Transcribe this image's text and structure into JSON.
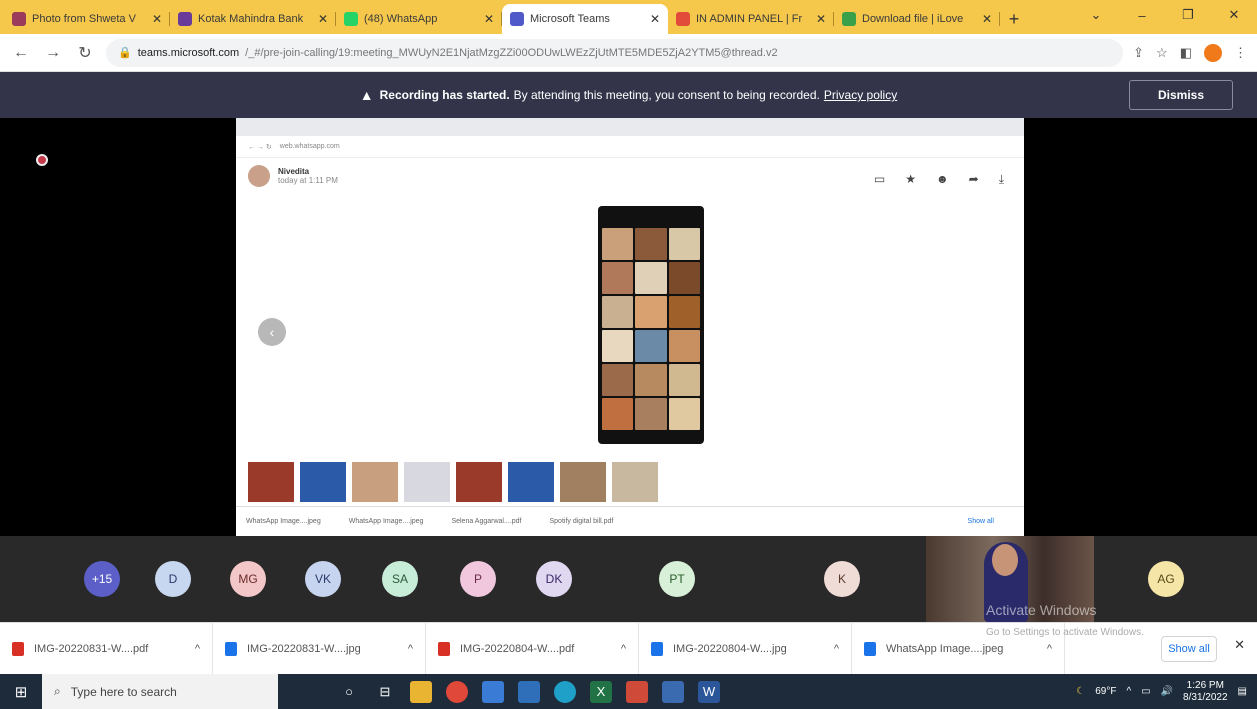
{
  "tabs": [
    {
      "title": "Photo from Shweta V",
      "favicon_color": "#9b3a5a",
      "close": "✕"
    },
    {
      "title": "Kotak Mahindra Bank",
      "favicon_color": "#6a3a9a",
      "close": "✕"
    },
    {
      "title": "(48) WhatsApp",
      "favicon_color": "#25d366",
      "close": "✕"
    },
    {
      "title": "Microsoft Teams",
      "favicon_color": "#5059c9",
      "close": "✕",
      "active": true
    },
    {
      "title": "IN ADMIN PANEL | Fr",
      "favicon_color": "#e24a3a",
      "close": "✕"
    },
    {
      "title": "Download file | iLove",
      "favicon_color": "#3aa04a",
      "close": "✕"
    }
  ],
  "new_tab": "+",
  "window_controls": {
    "minimize": "–",
    "restore": "❐",
    "close": "✕",
    "menu": "⌄"
  },
  "address": {
    "host": "teams.microsoft.com",
    "path": "/_#/pre-join-calling/19:meeting_MWUyN2E1NjatMzgZZi00ODUwLWEzZjUtMTE5MDE5ZjA2YTM5@thread.v2"
  },
  "banner": {
    "bold": "Recording has started.",
    "text": "By attending this meeting, you consent to being recorded.",
    "link": "Privacy policy",
    "dismiss": "Dismiss"
  },
  "shared": {
    "url": "web.whatsapp.com",
    "sender": "Nivedita",
    "time": "today at 1:11 PM",
    "downloads": [
      "WhatsApp Image....jpeg",
      "WhatsApp Image....jpeg",
      "Selena Aggarwal....pdf",
      "Spotify digital bill.pdf"
    ],
    "show_all": "Show all"
  },
  "participants": [
    {
      "initials": "+15",
      "color": "#5b5fc7",
      "text_color": "#ffffff"
    },
    {
      "initials": "D",
      "color": "#c7d7f0",
      "text_color": "#2a3a6a"
    },
    {
      "initials": "MG",
      "color": "#f3c7c7",
      "text_color": "#6a2a2a"
    },
    {
      "initials": "VK",
      "color": "#c7d4f0",
      "text_color": "#2a3a6a"
    },
    {
      "initials": "SA",
      "color": "#c7ecd7",
      "text_color": "#2a5a3a"
    },
    {
      "initials": "P",
      "color": "#f0c7dc",
      "text_color": "#6a2a4a"
    },
    {
      "initials": "DK",
      "color": "#e0d7f0",
      "text_color": "#3a2a6a"
    },
    {
      "initials": "PT",
      "color": "#d7f0d7",
      "text_color": "#2a5a2a"
    },
    {
      "initials": "K",
      "color": "#f0dcd7",
      "text_color": "#5a3a2a"
    },
    {
      "initials": "AG",
      "color": "#f5e6a8",
      "text_color": "#5a4a1a"
    }
  ],
  "activation": {
    "title": "Activate Windows",
    "subtitle": "Go to Settings to activate Windows."
  },
  "downloads": [
    {
      "name": "IMG-20220831-W....pdf",
      "icon_color": "#d93025"
    },
    {
      "name": "IMG-20220831-W....jpg",
      "icon_color": "#1a73e8"
    },
    {
      "name": "IMG-20220804-W....pdf",
      "icon_color": "#d93025"
    },
    {
      "name": "IMG-20220804-W....jpg",
      "icon_color": "#1a73e8"
    },
    {
      "name": "WhatsApp Image....jpeg",
      "icon_color": "#1a73e8"
    }
  ],
  "show_all": "Show all",
  "taskbar": {
    "search_placeholder": "Type here to search",
    "weather": "69°F",
    "time": "1:26 PM",
    "date": "8/31/2022"
  }
}
